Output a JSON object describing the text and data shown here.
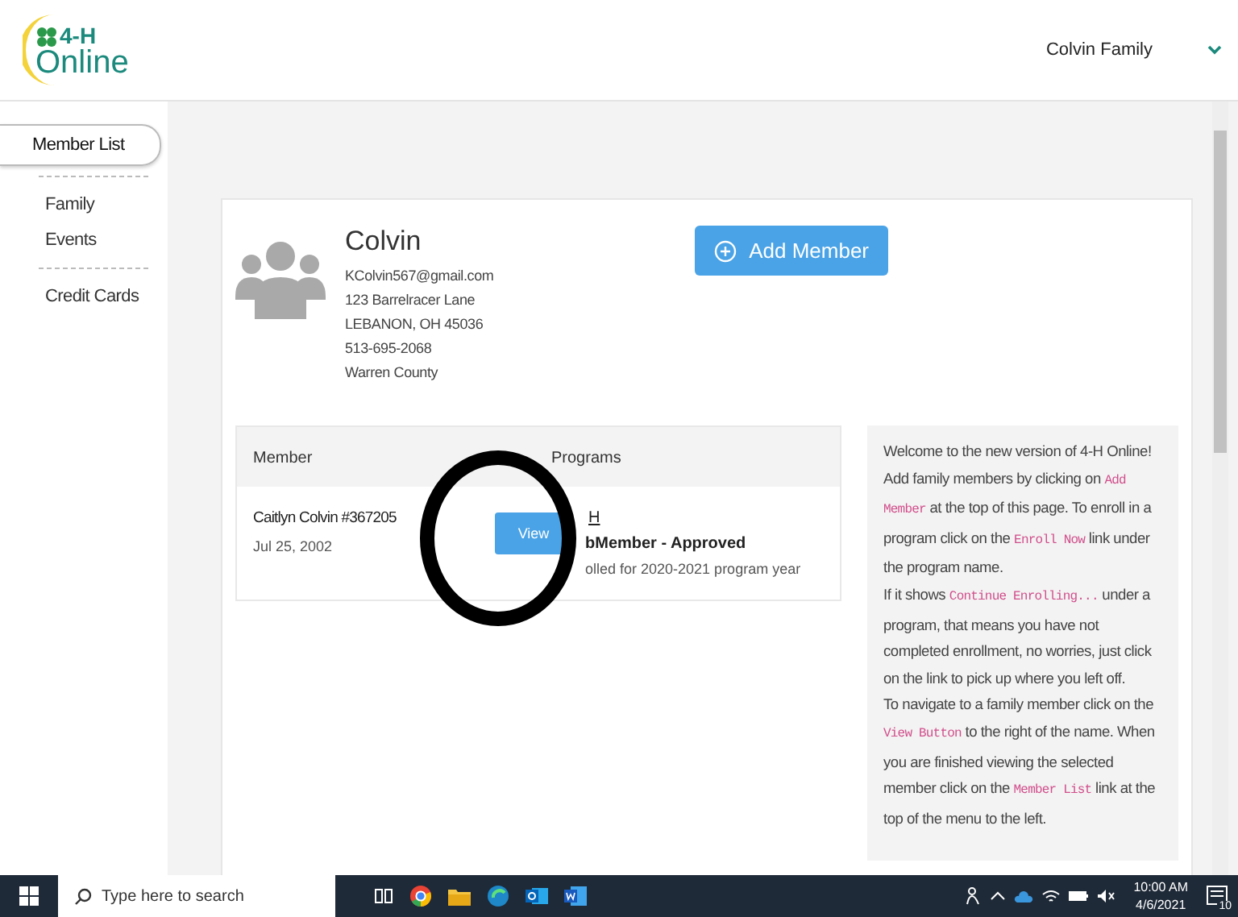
{
  "header": {
    "logo": {
      "line1": "4-H",
      "line2": "Online"
    },
    "account": "Colvin Family"
  },
  "sidebar": {
    "items": [
      {
        "label": "Member List",
        "selected": true,
        "divider_after": true
      },
      {
        "label": "Family",
        "selected": false,
        "divider_after": false
      },
      {
        "label": "Events",
        "selected": false,
        "divider_after": true
      },
      {
        "label": "Credit Cards",
        "selected": false,
        "divider_after": false
      }
    ]
  },
  "family": {
    "name": "Colvin",
    "details": [
      "KColvin567@gmail.com",
      "123 Barrelracer Lane",
      "LEBANON, OH 45036",
      "513-695-2068",
      "Warren County"
    ],
    "add_button": "Add Member"
  },
  "members_table": {
    "columns": [
      "Member",
      "Programs"
    ],
    "rows": [
      {
        "name": "Caitlyn Colvin #367205",
        "birth_date": "Jul 25, 2002",
        "view_button": "View",
        "program": "H",
        "status": "bMember - Approved",
        "note": "olled for 2020-2021 program year"
      }
    ]
  },
  "help": {
    "paragraphs": [
      [
        {
          "kind": "text",
          "text": "Welcome to the new version of 4-H Online!"
        }
      ],
      [
        {
          "kind": "text",
          "text": "Add family members by clicking on "
        },
        {
          "kind": "code",
          "text": "Add Member"
        },
        {
          "kind": "text",
          "text": " at the top of this page. To enroll in a program click on the "
        },
        {
          "kind": "code",
          "text": "Enroll Now"
        },
        {
          "kind": "text",
          "text": " link under the program name."
        }
      ],
      [
        {
          "kind": "text",
          "text": "If it shows "
        },
        {
          "kind": "code",
          "text": "Continue Enrolling..."
        },
        {
          "kind": "text",
          "text": " under a program, that means you have not completed enrollment, no worries, just click on the link to pick up where you left off."
        }
      ],
      [
        {
          "kind": "text",
          "text": "To navigate to a family member click on the "
        },
        {
          "kind": "code",
          "text": "View Button"
        },
        {
          "kind": "text",
          "text": " to the right of the name. When you are finished viewing the selected member click on the "
        },
        {
          "kind": "code",
          "text": "Member List"
        },
        {
          "kind": "text",
          "text": " link at the top of the menu to the left."
        }
      ]
    ]
  },
  "taskbar": {
    "search_placeholder": "Type here to search",
    "time": "10:00 AM",
    "date": "4/6/2021",
    "notifications": "10"
  }
}
